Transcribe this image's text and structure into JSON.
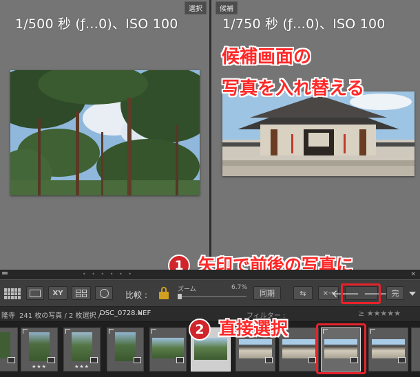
{
  "compare": {
    "select": {
      "tag": "選択",
      "info": "1/500 秒 (ƒ…0)、ISO 100"
    },
    "candidate": {
      "tag": "候補",
      "info": "1/750 秒 (ƒ…0)、ISO 100"
    }
  },
  "annotations": {
    "swap_line1": "候補画面の",
    "swap_line2": "写真を入れ替える",
    "step1_number": "1",
    "step1_text": "矢印で前後の写真に",
    "step2_number": "2",
    "step2_text": "直接選択",
    "highlight_color": "#e8222a"
  },
  "toolbar": {
    "compare_label": "比較 :",
    "zoom_label": "ズーム",
    "zoom_value": "6.7%",
    "sync_label": "同期",
    "done_label": "完",
    "xy_label": "XY"
  },
  "filmstrip_bar": {
    "source": "隆寺",
    "count": "241 枚の写真 / 2 枚選択 /",
    "filename": "DSC_0728.NEF",
    "filter_label": "フィルター :"
  },
  "filmstrip": {
    "thumbs": [
      {
        "kind": "tree",
        "stars": ""
      },
      {
        "kind": "tree",
        "stars": "★★★"
      },
      {
        "kind": "tree",
        "stars": "★★★"
      },
      {
        "kind": "tree",
        "stars": ""
      },
      {
        "kind": "tree",
        "stars": ""
      },
      {
        "kind": "tree",
        "stars": ""
      },
      {
        "kind": "temple",
        "stars": ""
      },
      {
        "kind": "temple",
        "stars": ""
      },
      {
        "kind": "temple",
        "stars": ""
      },
      {
        "kind": "temple",
        "stars": ""
      }
    ]
  }
}
